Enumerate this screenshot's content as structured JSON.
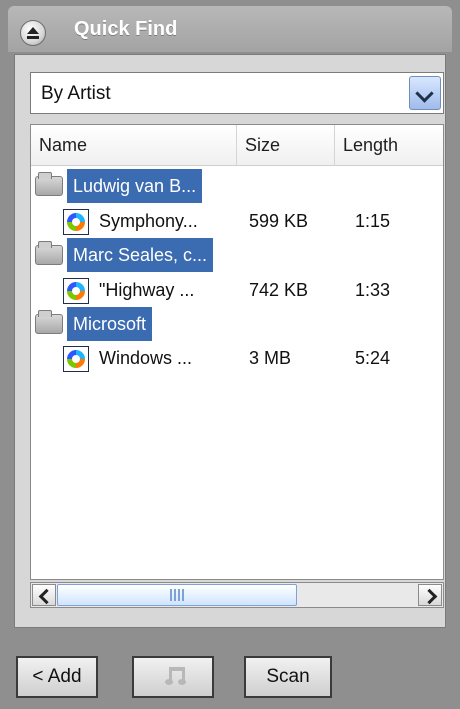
{
  "title": "Quick Find",
  "filter": {
    "selected": "By Artist"
  },
  "columns": {
    "name": "Name",
    "size": "Size",
    "length": "Length"
  },
  "rows": [
    {
      "type": "folder",
      "label": "Ludwig van B..."
    },
    {
      "type": "track",
      "name": "Symphony...",
      "size": "599 KB",
      "length": "1:15"
    },
    {
      "type": "folder",
      "label": "Marc Seales, c..."
    },
    {
      "type": "track",
      "name": "\"Highway ...",
      "size": "742 KB",
      "length": "1:33"
    },
    {
      "type": "folder",
      "label": "Microsoft"
    },
    {
      "type": "track",
      "name": "Windows ...",
      "size": "3 MB",
      "length": "5:24"
    }
  ],
  "scrollbar": {
    "grip": "III"
  },
  "buttons": {
    "add": "< Add",
    "scan": "Scan"
  },
  "icons": {
    "title": "eject-icon",
    "dropdown": "chevron-down-icon",
    "folder": "folder-icon",
    "track": "media-file-icon",
    "music": "music-note-icon",
    "left": "chevron-left-icon",
    "right": "chevron-right-icon"
  },
  "colors": {
    "selection": "#3b6bb0",
    "panel": "#8f8f8f",
    "title": "#ffffff"
  }
}
